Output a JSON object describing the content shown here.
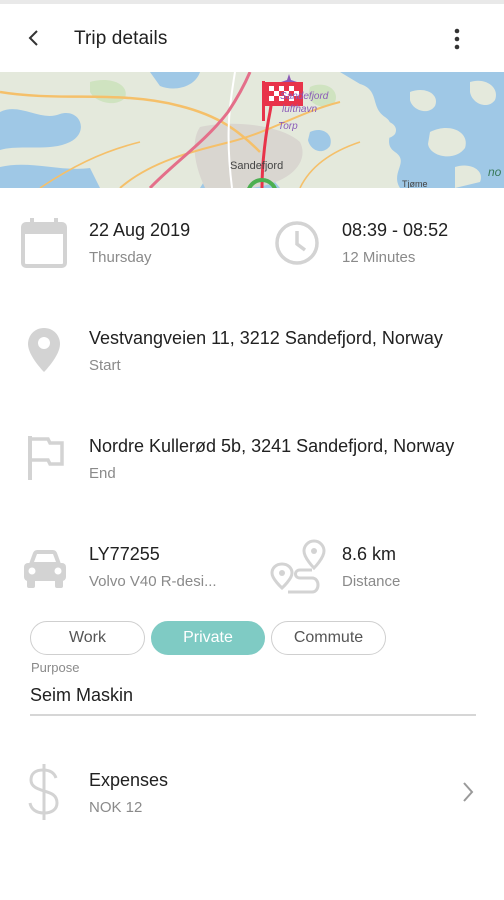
{
  "header": {
    "title": "Trip details"
  },
  "map": {
    "labels": {
      "city": "Sandefjord",
      "airport_line1": "Sandefjord",
      "airport_line2": "lufthavn",
      "airport_line3": "Torp",
      "place": "Tjøme",
      "edge": "no"
    }
  },
  "trip": {
    "date": "22 Aug 2019",
    "weekday": "Thursday",
    "time_range": "08:39 - 08:52",
    "duration": "12 Minutes",
    "start_address": "Vestvangveien 11, 3212 Sandefjord, Norway",
    "start_label": "Start",
    "end_address": "Nordre Kullerød 5b, 3241 Sandefjord, Norway",
    "end_label": "End",
    "vehicle_plate": "LY77255",
    "vehicle_model": "Volvo V40 R-desi...",
    "distance": "8.6 km",
    "distance_label": "Distance"
  },
  "purpose_chips": [
    {
      "label": "Work",
      "selected": false
    },
    {
      "label": "Private",
      "selected": true
    },
    {
      "label": "Commute",
      "selected": false
    }
  ],
  "purpose": {
    "label": "Purpose",
    "value": "Seim Maskin"
  },
  "expenses": {
    "title": "Expenses",
    "amount": "NOK 12"
  },
  "colors": {
    "accent": "#7fcbc4",
    "icon_gray": "#d3d3d3",
    "route_red": "#e8334a",
    "start_green": "#4caf50"
  }
}
